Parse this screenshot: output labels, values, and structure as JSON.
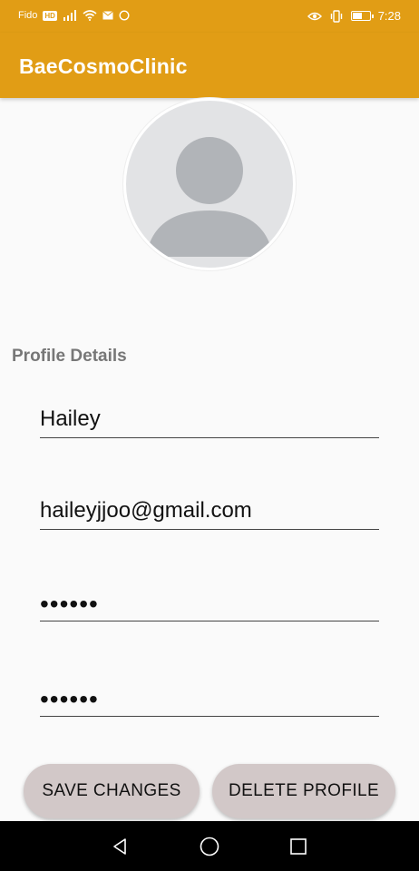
{
  "status_bar": {
    "carrier": "Fido",
    "network_badge": "HD",
    "time": "7:28",
    "battery_percent": 60,
    "icons": [
      "signal-icon",
      "wifi-icon",
      "mail-icon",
      "sync-icon",
      "eye-icon",
      "vibrate-icon",
      "battery-icon"
    ]
  },
  "app_bar": {
    "title": "BaeCosmoClinic",
    "color": "#e19d15"
  },
  "profile": {
    "avatar_icon": "person-placeholder-icon",
    "section_title": "Profile Details",
    "fields": {
      "name": "Hailey",
      "email": "haileyjjoo@gmail.com",
      "password": "••••••",
      "confirm_password": "••••••"
    }
  },
  "buttons": {
    "save_label": "SAVE CHANGES",
    "delete_label": "DELETE PROFILE",
    "background": "#d2c8c8"
  },
  "nav_bar": {
    "icons": [
      "back-icon",
      "home-icon",
      "recents-icon"
    ]
  }
}
